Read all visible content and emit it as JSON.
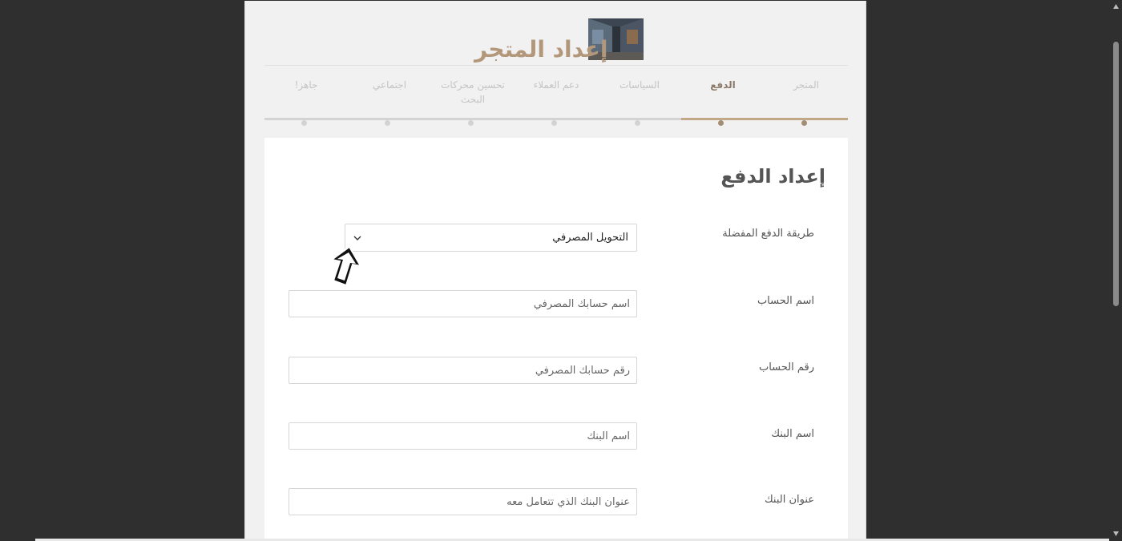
{
  "header": {
    "title": "إعداد المتجر"
  },
  "steps": [
    {
      "label": "المتجر",
      "state": "done"
    },
    {
      "label": "الدفع",
      "state": "active"
    },
    {
      "label": "السياسات",
      "state": "pending"
    },
    {
      "label": "دعم العملاء",
      "state": "pending"
    },
    {
      "label": "تحسين محركات البحث",
      "state": "pending"
    },
    {
      "label": "اجتماعي",
      "state": "pending"
    },
    {
      "label": "جاهز!",
      "state": "pending"
    }
  ],
  "progress": {
    "completed_steps": 2,
    "total_steps": 7
  },
  "card": {
    "title": "إعداد الدفع"
  },
  "form": {
    "payment_method_label": "طريقة الدفع المفضلة",
    "payment_method_value": "التحويل المصرفي",
    "account_name_label": "اسم الحساب",
    "account_name_placeholder": "اسم حسابك المصرفي",
    "account_number_label": "رقم الحساب",
    "account_number_placeholder": "رقم حسابك المصرفي",
    "bank_name_label": "اسم البنك",
    "bank_name_placeholder": "اسم البنك",
    "bank_address_label": "عنوان البنك",
    "bank_address_placeholder": "عنوان البنك الذي تتعامل معه"
  },
  "colors": {
    "accent": "#c2a887",
    "title": "#b3977a",
    "background": "#2f2f2f"
  },
  "icons": {
    "select": "chevron-down-icon",
    "pointer": "arrow-cursor-icon"
  }
}
